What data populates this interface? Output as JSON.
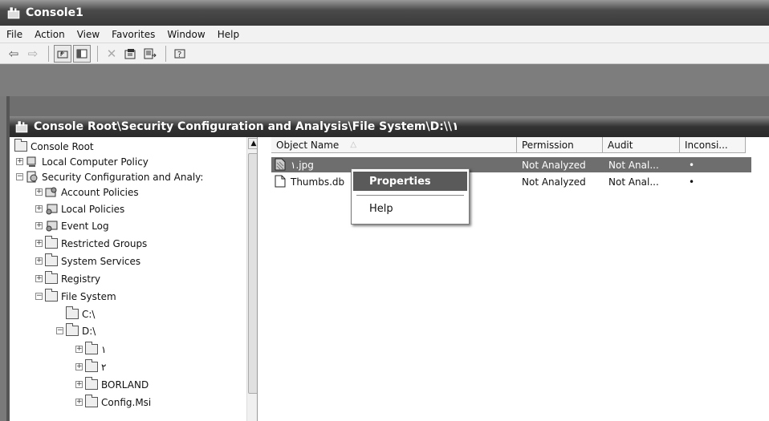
{
  "window": {
    "title": "Console1"
  },
  "menu": [
    "File",
    "Action",
    "View",
    "Favorites",
    "Window",
    "Help"
  ],
  "toolbar_icons": [
    "back-icon",
    "forward-icon",
    "up-level-icon",
    "show-hide-tree-icon",
    "delete-icon",
    "properties-icon",
    "export-list-icon",
    "help-icon"
  ],
  "inner_window": {
    "title": "Console Root\\Security Configuration and Analysis\\File System\\D:\\\\١"
  },
  "tree": {
    "items": [
      {
        "label": "Console Root"
      },
      {
        "label": "Local Computer Policy"
      },
      {
        "label": "Security Configuration and Analy:"
      },
      {
        "label": "Account Policies"
      },
      {
        "label": "Local Policies"
      },
      {
        "label": "Event Log"
      },
      {
        "label": "Restricted Groups"
      },
      {
        "label": "System Services"
      },
      {
        "label": "Registry"
      },
      {
        "label": "File System"
      },
      {
        "label": "C:\\"
      },
      {
        "label": "D:\\"
      },
      {
        "label": "١"
      },
      {
        "label": "٢"
      },
      {
        "label": "BORLAND"
      },
      {
        "label": "Config.Msi"
      }
    ]
  },
  "list": {
    "columns": [
      "Object Name",
      "Permission",
      "Audit",
      "Inconsi..."
    ],
    "sort_indicator": "△",
    "rows": [
      {
        "name": "١.jpg",
        "permission": "Not Analyzed",
        "audit": "Not Anal...",
        "inconsistent": "•"
      },
      {
        "name": "Thumbs.db",
        "permission": "Not Analyzed",
        "audit": "Not Anal...",
        "inconsistent": "•"
      }
    ]
  },
  "context_menu": {
    "items": [
      "Properties",
      "Help"
    ]
  }
}
